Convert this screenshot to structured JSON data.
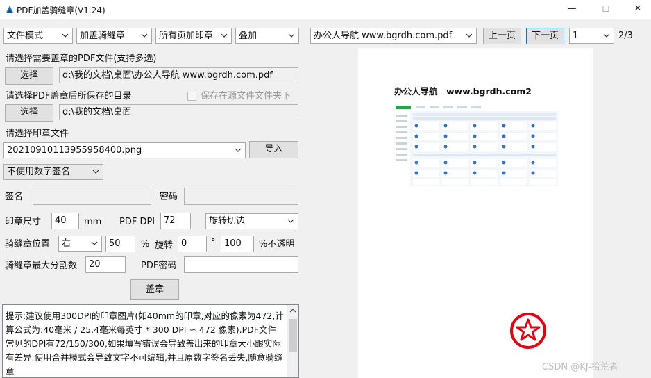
{
  "window": {
    "title": "PDF加盖骑缝章(V1.24)",
    "minimize_label": "—",
    "maximize_label": "☐",
    "close_label": "✕"
  },
  "toolbar": {
    "mode": "文件模式",
    "stamp_type": "加盖骑缝章",
    "pages": "所有页加印章",
    "blend": "叠加",
    "current_file": "办公人导航 www.bgrdh.com.pdf",
    "prev_label": "上一页",
    "next_label": "下一页",
    "page_select": "1",
    "page_count": "2/3"
  },
  "source": {
    "label": "请选择需要盖章的PDF文件(支持多选)",
    "button": "选择",
    "path": "d:\\我的文档\\桌面\\办公人导航 www.bgrdh.com.pdf"
  },
  "output": {
    "label": "请选择PDF盖章后所保存的目录",
    "save_in_source_label": "保存在源文件文件夹下",
    "save_in_source_checked": false,
    "button": "选择",
    "path": "d:\\我的文档\\桌面"
  },
  "stamp": {
    "label": "请选择印章文件",
    "file": "20210910113955958400.png",
    "import_label": "导入"
  },
  "signature": {
    "mode": "不使用数字签名",
    "name_label": "签名",
    "name_value": "",
    "password_label": "密码",
    "password_value": ""
  },
  "settings": {
    "size_label": "印章尺寸",
    "size_value": "40",
    "size_unit": "mm",
    "dpi_label": "PDF DPI",
    "dpi_value": "72",
    "rotate_mode": "旋转切边",
    "position_label": "骑缝章位置",
    "position_value": "右",
    "position_percent": "50",
    "percent_sign": "%",
    "rotate_label": "旋转",
    "rotate_value": "0",
    "degree_sign": "°",
    "opacity_value": "100",
    "opacity_label": "%不透明",
    "max_split_label": "骑缝章最大分割数",
    "max_split_value": "20",
    "pdf_password_label": "PDF密码",
    "pdf_password_value": ""
  },
  "action": {
    "stamp_button": "盖章"
  },
  "notes": {
    "text": "提示:建议使用300DPI的印章图片(如40mm的印章,对应的像素为472,计算公式为:40毫米 / 25.4毫米每英寸 * 300 DPI ≈ 472 像素).PDF文件常见的DPI有72/150/300,如果填写错误会导致盖出来的印章大小跟实际有差异.使用合并模式会导致文字不可编辑,并且原数字签名丢失,随意骑缝章"
  },
  "preview": {
    "heading": "办公人导航　www.bgrdh.com2"
  },
  "watermark": "CSDN @KJ-拾荒者",
  "colors": {
    "accent": "#0078d7",
    "stamp_red": "#e60012",
    "window_bg": "#f0f0f0"
  }
}
